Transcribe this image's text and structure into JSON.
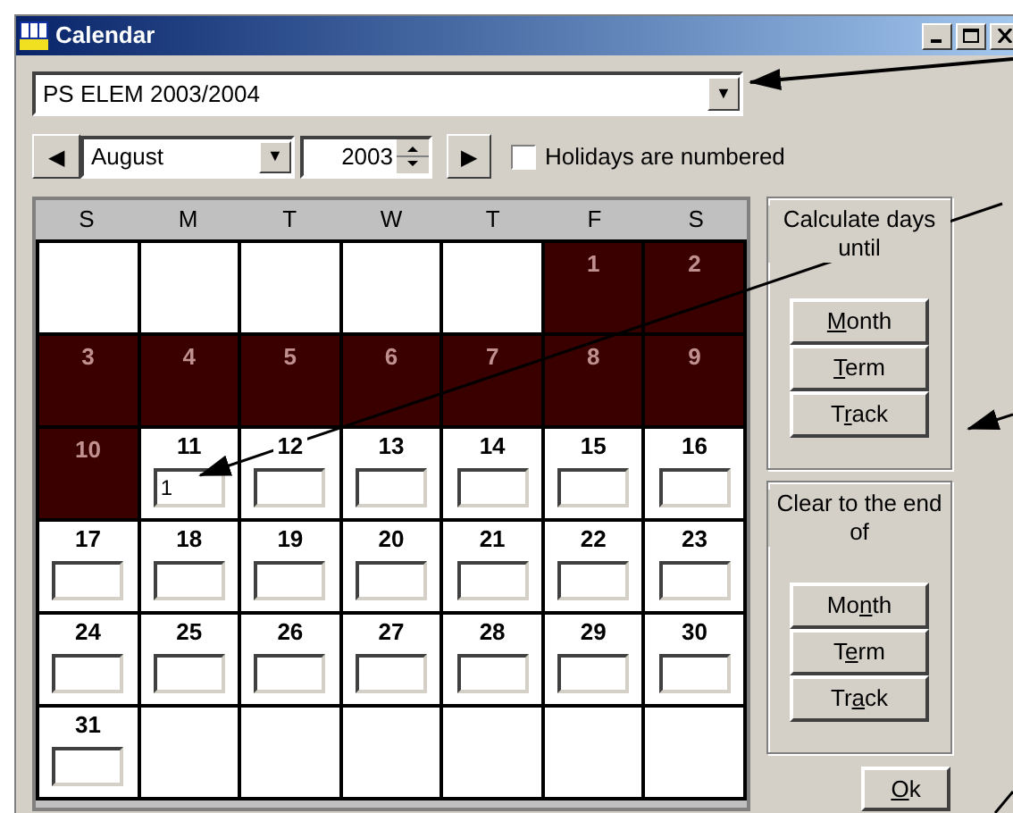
{
  "window": {
    "title": "Calendar"
  },
  "calendar_select": {
    "value": "PS ELEM 2003/2004",
    "arrow": "▼"
  },
  "nav": {
    "prev": "◀",
    "next": "▶",
    "month": "August",
    "month_arrow": "▼",
    "year": "2003",
    "holidays_numbered": {
      "label": "Holidays are numbered",
      "checked": false
    }
  },
  "weekdays": [
    "S",
    "M",
    "T",
    "W",
    "T",
    "F",
    "S"
  ],
  "weeks": [
    [
      {
        "kind": "blank"
      },
      {
        "kind": "blank"
      },
      {
        "kind": "blank"
      },
      {
        "kind": "blank"
      },
      {
        "kind": "blank"
      },
      {
        "kind": "holiday",
        "day": "1"
      },
      {
        "kind": "holiday",
        "day": "2"
      }
    ],
    [
      {
        "kind": "holiday",
        "day": "3"
      },
      {
        "kind": "holiday",
        "day": "4"
      },
      {
        "kind": "holiday",
        "day": "5"
      },
      {
        "kind": "holiday",
        "day": "6"
      },
      {
        "kind": "holiday",
        "day": "7"
      },
      {
        "kind": "holiday",
        "day": "8"
      },
      {
        "kind": "holiday",
        "day": "9"
      }
    ],
    [
      {
        "kind": "holiday",
        "day": "10"
      },
      {
        "kind": "day",
        "day": "11",
        "value": "1"
      },
      {
        "kind": "day",
        "day": "12"
      },
      {
        "kind": "day",
        "day": "13"
      },
      {
        "kind": "day",
        "day": "14"
      },
      {
        "kind": "day",
        "day": "15"
      },
      {
        "kind": "day",
        "day": "16"
      }
    ],
    [
      {
        "kind": "day",
        "day": "17"
      },
      {
        "kind": "day",
        "day": "18"
      },
      {
        "kind": "day",
        "day": "19"
      },
      {
        "kind": "day",
        "day": "20"
      },
      {
        "kind": "day",
        "day": "21"
      },
      {
        "kind": "day",
        "day": "22"
      },
      {
        "kind": "day",
        "day": "23"
      }
    ],
    [
      {
        "kind": "day",
        "day": "24"
      },
      {
        "kind": "day",
        "day": "25"
      },
      {
        "kind": "day",
        "day": "26"
      },
      {
        "kind": "day",
        "day": "27"
      },
      {
        "kind": "day",
        "day": "28"
      },
      {
        "kind": "day",
        "day": "29"
      },
      {
        "kind": "day",
        "day": "30"
      }
    ],
    [
      {
        "kind": "day",
        "day": "31"
      },
      {
        "kind": "blank"
      },
      {
        "kind": "blank"
      },
      {
        "kind": "blank"
      },
      {
        "kind": "blank"
      },
      {
        "kind": "blank"
      },
      {
        "kind": "blank"
      }
    ]
  ],
  "panels": [
    {
      "title": "Calculate days until",
      "buttons": [
        {
          "key": "M",
          "after": "onth"
        },
        {
          "key": "T",
          "after": "erm"
        },
        {
          "before": "T",
          "key": "r",
          "after": "ack"
        }
      ]
    },
    {
      "title": "Clear to the end of",
      "buttons": [
        {
          "before": "Mo",
          "key": "n",
          "after": "th"
        },
        {
          "before": "T",
          "key": "e",
          "after": "rm"
        },
        {
          "before": "Tr",
          "key": "a",
          "after": "ck"
        }
      ]
    }
  ],
  "ok_button": {
    "key": "O",
    "after": "k"
  }
}
